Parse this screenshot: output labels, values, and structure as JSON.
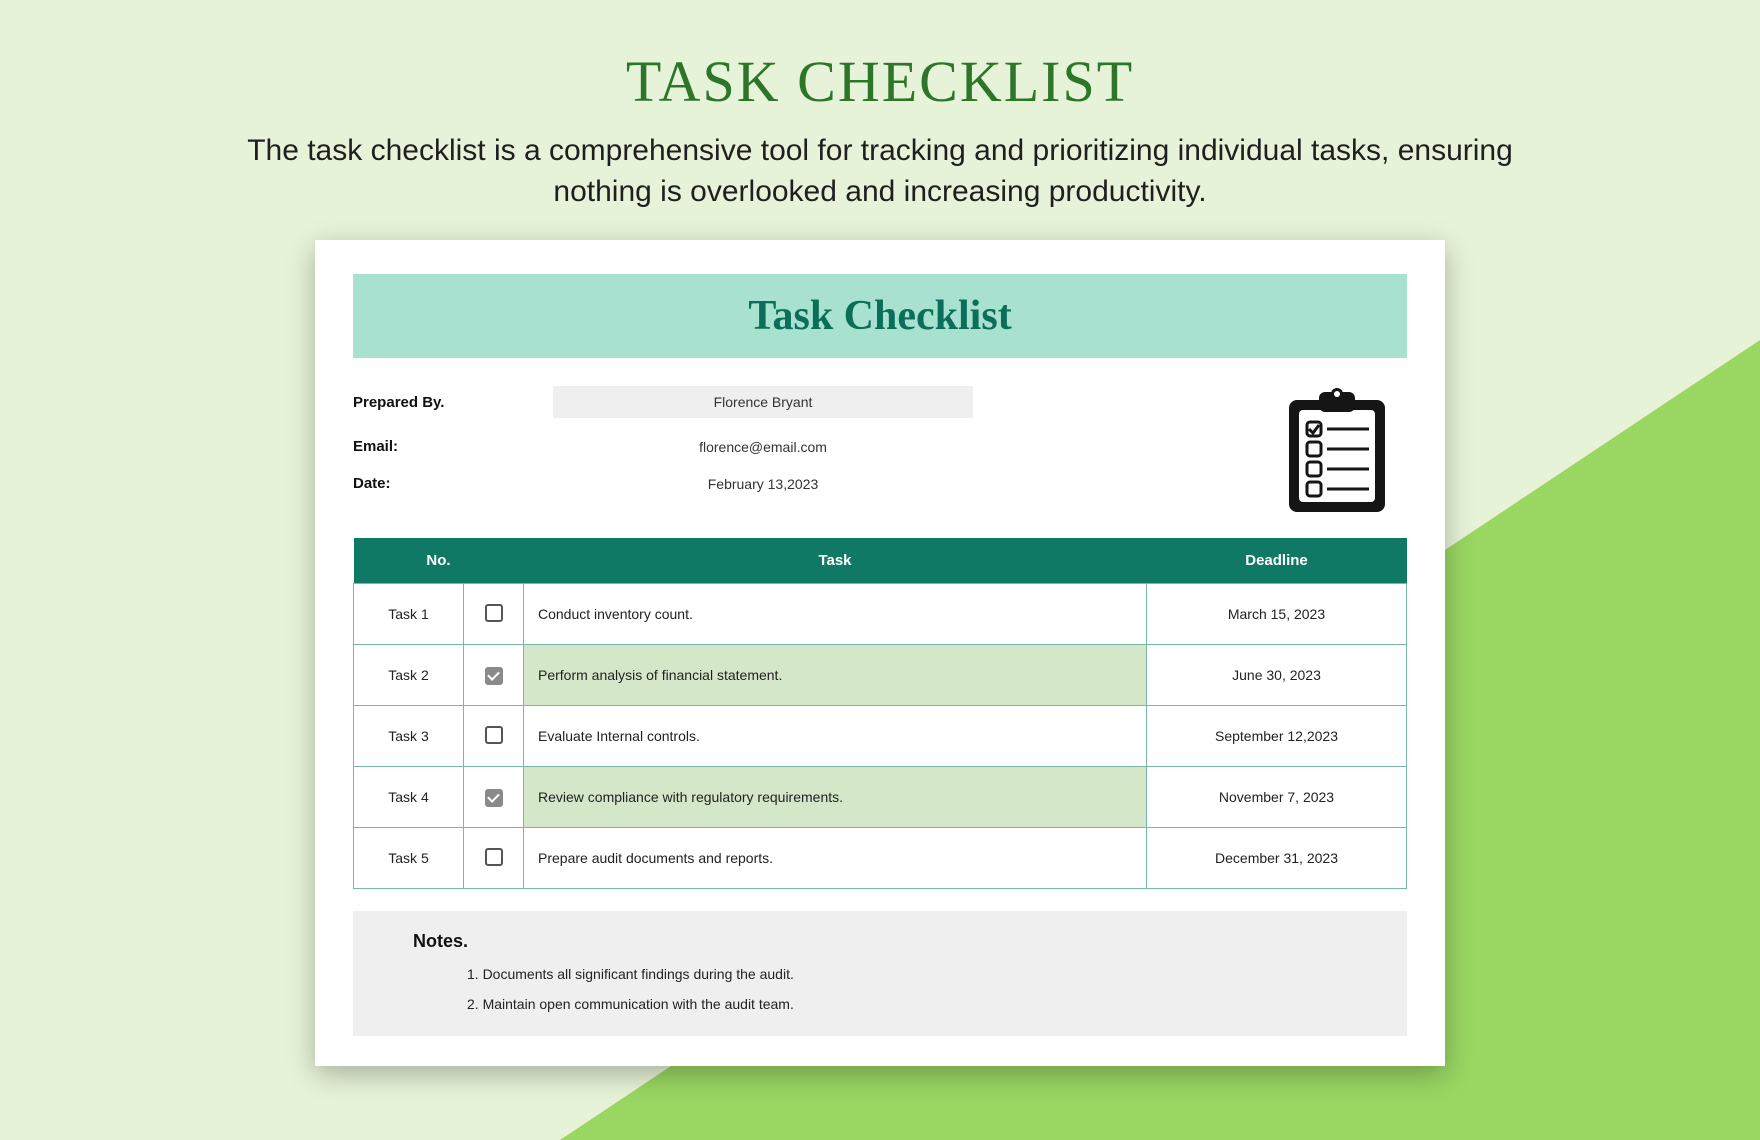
{
  "page": {
    "title": "TASK CHECKLIST",
    "subtitle": "The task checklist is a comprehensive tool for tracking and prioritizing individual tasks, ensuring nothing is overlooked and increasing productivity."
  },
  "card": {
    "banner": "Task Checklist",
    "meta": {
      "prepared_by_label": "Prepared By.",
      "prepared_by_value": "Florence Bryant",
      "email_label": "Email:",
      "email_value": "florence@email.com",
      "date_label": "Date:",
      "date_value": "February 13,2023"
    },
    "table": {
      "headers": {
        "no": "No.",
        "task": "Task",
        "deadline": "Deadline"
      },
      "rows": [
        {
          "no": "Task 1",
          "checked": false,
          "task": "Conduct inventory count.",
          "deadline": "March 15, 2023"
        },
        {
          "no": "Task 2",
          "checked": true,
          "task": "Perform analysis of financial statement.",
          "deadline": "June 30, 2023"
        },
        {
          "no": "Task 3",
          "checked": false,
          "task": "Evaluate Internal controls.",
          "deadline": "September 12,2023"
        },
        {
          "no": "Task 4",
          "checked": true,
          "task": "Review compliance with regulatory requirements.",
          "deadline": "November 7, 2023"
        },
        {
          "no": "Task 5",
          "checked": false,
          "task": "Prepare audit documents and reports.",
          "deadline": "December 31, 2023"
        }
      ]
    },
    "notes": {
      "title": "Notes.",
      "items": [
        "1. Documents all significant findings during the audit.",
        "2. Maintain open communication with the audit team."
      ]
    }
  }
}
